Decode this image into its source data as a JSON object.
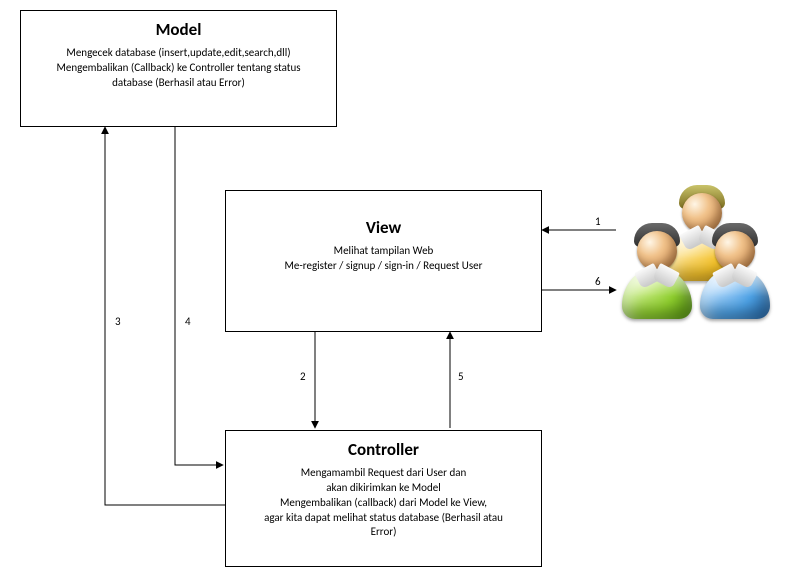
{
  "boxes": {
    "model": {
      "title": "Model",
      "desc_l1": "Mengecek database (insert,update,edit,search,dll)",
      "desc_l2": "Mengembalikan (Callback) ke Controller tentang status",
      "desc_l3": "database (Berhasil atau Error)"
    },
    "view": {
      "title": "View",
      "desc_l1": "Melihat tampilan Web",
      "desc_l2": "Me-register / signup / sign-in / Request User"
    },
    "controller": {
      "title": "Controller",
      "desc_l1": "Mengamambil Request dari User dan",
      "desc_l2": "akan dikirimkan ke Model",
      "desc_l3": "Mengembalikan (callback) dari Model ke View,",
      "desc_l4": "agar kita dapat melihat status database (Berhasil atau",
      "desc_l5": "Error)"
    }
  },
  "labels": {
    "n1": "1",
    "n2": "2",
    "n3": "3",
    "n4": "4",
    "n5": "5",
    "n6": "6"
  }
}
